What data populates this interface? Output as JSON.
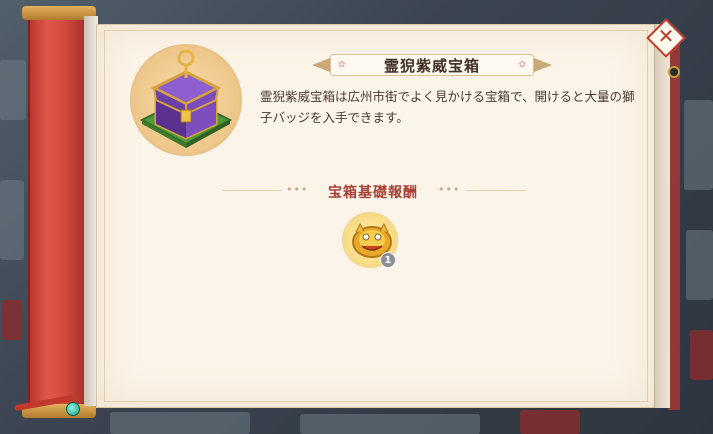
{
  "chest": {
    "title": "霊猊紫威宝箱",
    "description": "霊猊紫威宝箱は広州市街でよく見かける宝箱で、開けると大量の獅子バッジを入手できます。"
  },
  "rewards_section": {
    "title": "宝箱基礎報酬",
    "items": [
      {
        "icon": "lion-badge-icon",
        "count": "1"
      }
    ]
  },
  "colors": {
    "scroll_red": "#d44a3f",
    "paper": "#fbf4e8",
    "section_title": "#a93f36",
    "title_text": "#3f3028"
  },
  "icons": [
    "treasure-chest-icon",
    "lion-badge-icon",
    "close-icon"
  ]
}
